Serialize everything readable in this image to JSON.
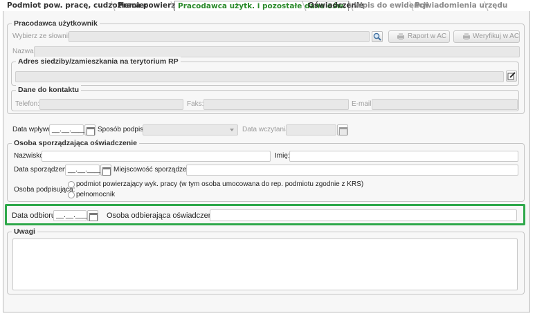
{
  "tabs": [
    {
      "label": "Podmiot pow. pracę, cudzoziemiec"
    },
    {
      "label": "Praca powierzona"
    },
    {
      "label": "Pracodawca użytk. i pozostałe dane ośw."
    },
    {
      "label": "Oświadczenie"
    },
    {
      "label": "Wpis do ewidencji"
    },
    {
      "label": "Powiadomienia urzędu"
    }
  ],
  "employer": {
    "legend": "Pracodawca użytkownik",
    "dictionary_label": "Wybierz ze słownika:",
    "report_button": "Raport w AC",
    "verify_button": "Weryfikuj w AC",
    "name_label": "Nazwa:",
    "address_legend": "Adres siedziby/zamieszkania na terytorium RP",
    "contact_legend": "Dane do kontaktu",
    "phone_label": "Telefon:",
    "fax_label": "Faks:",
    "email_label": "E-mail:"
  },
  "intake": {
    "received_label": "Data wpływu:",
    "received_value": "__.__.____",
    "sign_method_label": "Sposób podpisu:",
    "load_date_label": "Data wczytania:"
  },
  "preparer": {
    "legend": "Osoba sporządzająca oświadczenie",
    "surname_label": "Nazwisko:",
    "firstname_label": "Imię:",
    "prep_date_label": "Data sporządzenia:",
    "prep_date_value": "__.__.____",
    "place_label": "Miejscowość sporządzenia:",
    "signer_label": "Osoba podpisująca:",
    "signer_options": [
      "podmiot powierzający wyk. pracy (w tym osoba umocowana do rep. podmiotu zgodnie z KRS)",
      "pełnomocnik"
    ]
  },
  "pickup": {
    "date_label": "Data odbioru:",
    "date_value": "__.__.____",
    "person_label": "Osoba odbierająca oświadczenie:"
  },
  "remarks": {
    "legend": "Uwagi"
  },
  "colors": {
    "active_tab": "#2a8a2a",
    "highlight": "#2ea84a"
  }
}
